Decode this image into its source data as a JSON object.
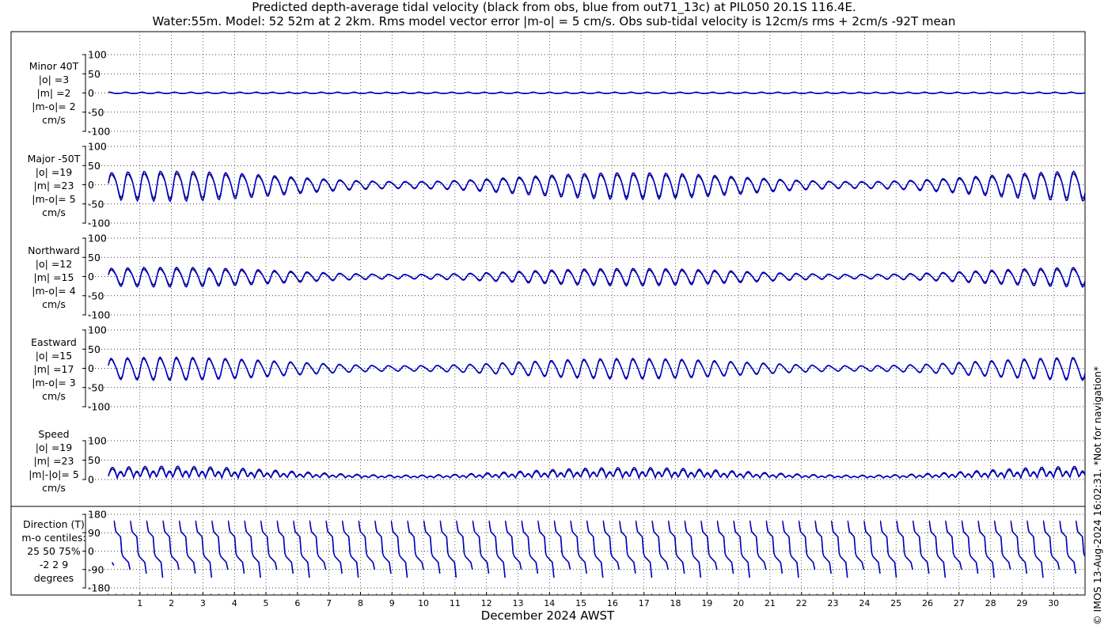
{
  "title_line1": "Predicted depth-average tidal velocity (black from obs, blue from out71_13c) at PIL050 20.1S 116.4E.",
  "title_line2": "Water:55m. Model: 52 52m at 2 2km. Rms model vector error |m-o| = 5 cm/s. Obs sub-tidal velocity is 12cm/s rms + 2cm/s -92T mean",
  "credit": "© IMOS 13-Aug-2024 16:02:31. *Not for navigation*",
  "xlabel": "December 2024 AWST",
  "colors": {
    "obs": "#000000",
    "model": "#0000cc"
  },
  "panels": [
    {
      "label_lines": [
        "Minor 40T",
        "|o| =3",
        "|m| =2",
        "|m-o|= 2",
        "cm/s"
      ]
    },
    {
      "label_lines": [
        "Major -50T",
        "|o| =19",
        "|m| =23",
        "|m-o|= 5",
        "cm/s"
      ]
    },
    {
      "label_lines": [
        "Northward",
        "|o| =12",
        "|m| =15",
        "|m-o|= 4",
        "cm/s"
      ]
    },
    {
      "label_lines": [
        "Eastward",
        "|o| =15",
        "|m| =17",
        "|m-o|= 3",
        "cm/s"
      ]
    },
    {
      "label_lines": [
        "Speed",
        "|o| =19",
        "|m| =23",
        "|m|-|o|= 5",
        "cm/s"
      ]
    },
    {
      "label_lines": [
        "Direction (T)",
        "m-o centiles:",
        "25  50  75%",
        "-2  2  9",
        "degrees"
      ]
    }
  ],
  "chart_data": [
    {
      "type": "line",
      "name": "Minor 40T",
      "yticks": [
        "100",
        "50",
        "0",
        "-50",
        "-100"
      ],
      "ylim": [
        -100,
        100
      ],
      "series": [
        {
          "name": "obs",
          "amplitude": 3
        },
        {
          "name": "model",
          "amplitude": 2
        }
      ]
    },
    {
      "type": "line",
      "name": "Major -50T",
      "yticks": [
        "100",
        "50",
        "0",
        "-50",
        "-100"
      ],
      "ylim": [
        -100,
        100
      ],
      "series": [
        {
          "name": "obs",
          "amplitude": 19
        },
        {
          "name": "model",
          "amplitude": 23
        }
      ]
    },
    {
      "type": "line",
      "name": "Northward",
      "yticks": [
        "100",
        "50",
        "0",
        "-50",
        "-100"
      ],
      "ylim": [
        -100,
        100
      ],
      "series": [
        {
          "name": "obs",
          "amplitude": 12
        },
        {
          "name": "model",
          "amplitude": 15
        }
      ]
    },
    {
      "type": "line",
      "name": "Eastward",
      "yticks": [
        "100",
        "50",
        "0",
        "-50",
        "-100"
      ],
      "ylim": [
        -100,
        100
      ],
      "series": [
        {
          "name": "obs",
          "amplitude": 15
        },
        {
          "name": "model",
          "amplitude": 17
        }
      ]
    },
    {
      "type": "line",
      "name": "Speed",
      "yticks": [
        "100",
        "50",
        "0"
      ],
      "ylim": [
        0,
        100
      ],
      "series": [
        {
          "name": "obs",
          "amplitude": 19
        },
        {
          "name": "model",
          "amplitude": 23
        }
      ]
    },
    {
      "type": "line",
      "name": "Direction (T)",
      "yticks": [
        "180",
        "90",
        "0",
        "-90",
        "-180"
      ],
      "ylim": [
        -180,
        180
      ],
      "series": [
        {
          "name": "obs"
        },
        {
          "name": "model"
        }
      ]
    }
  ],
  "x_axis": {
    "days": [
      "1",
      "2",
      "3",
      "4",
      "5",
      "6",
      "7",
      "8",
      "9",
      "10",
      "11",
      "12",
      "13",
      "14",
      "15",
      "16",
      "17",
      "18",
      "19",
      "20",
      "21",
      "22",
      "23",
      "24",
      "25",
      "26",
      "27",
      "28",
      "29",
      "30"
    ],
    "xlim_days": [
      0,
      31
    ],
    "grid": true
  }
}
